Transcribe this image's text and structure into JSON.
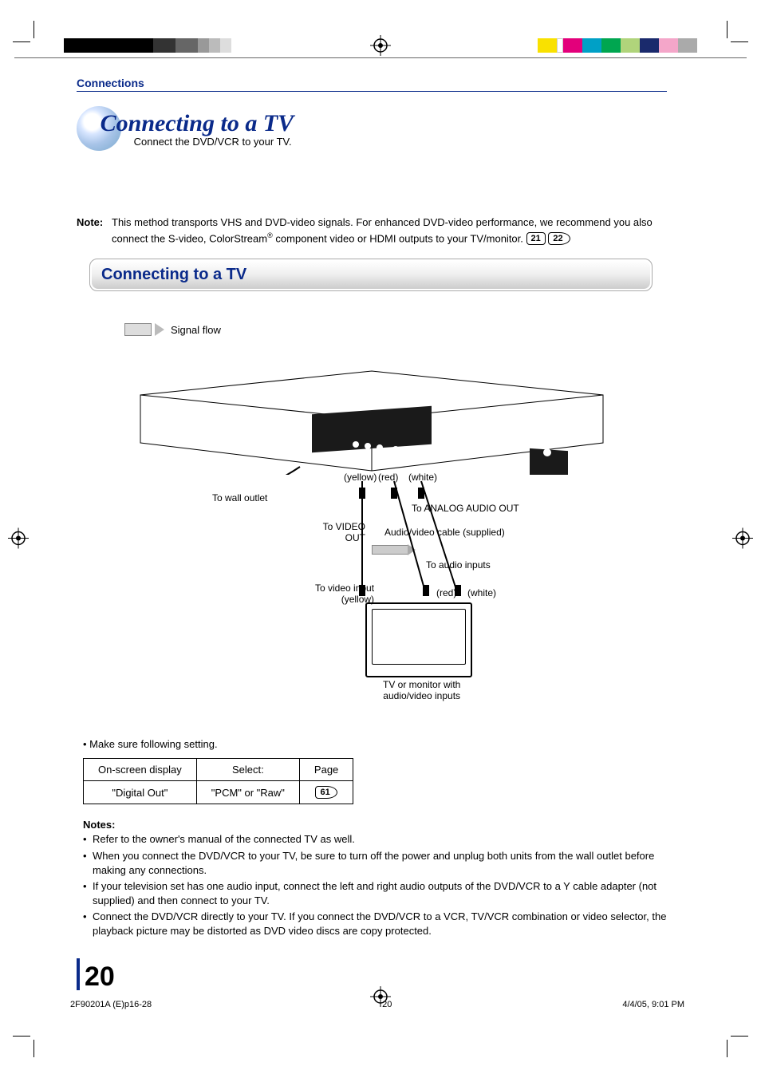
{
  "section_label": "Connections",
  "title": "Connecting to a TV",
  "subtitle": "Connect the DVD/VCR to your TV.",
  "note_label": "Note:",
  "note_text_pre": "This method transports VHS and DVD-video signals. For enhanced DVD-video performance, we recommend you also connect the S-video, ColorStream",
  "note_reg": "®",
  "note_text_post": " component video or HDMI outputs to your TV/monitor. ",
  "note_ref1": "21",
  "note_ref2": "22",
  "proc_heading": "Connecting to a TV",
  "diagram": {
    "signal_flow": "Signal flow",
    "to_wall": "To wall outlet",
    "yellow": "(yellow)",
    "red": "(red)",
    "white": "(white)",
    "to_analog_audio": "To ANALOG AUDIO OUT",
    "to_video_out_1": "To VIDEO",
    "to_video_out_2": "OUT",
    "av_cable": "Audio/video cable (supplied)",
    "to_audio_inputs": "To audio inputs",
    "to_video_input": "To video input",
    "yellow2": "(yellow)",
    "red2": "(red)",
    "white2": "(white)",
    "tv_caption_1": "TV or monitor with",
    "tv_caption_2": "audio/video inputs"
  },
  "setting_intro": "• Make sure following setting.",
  "table": {
    "h1": "On-screen display",
    "h2": "Select:",
    "h3": "Page",
    "r1c1": "\"Digital Out\"",
    "r1c2": "\"PCM\" or \"Raw\"",
    "r1c3": "61"
  },
  "notes_head": "Notes:",
  "notes": [
    "Refer to the owner's manual of the connected TV as well.",
    "When you connect the DVD/VCR to your TV, be sure to turn off the power and unplug both units from the wall outlet before making any connections.",
    "If your television set has one audio input, connect the left and right audio outputs of the DVD/VCR to a Y cable adapter (not supplied) and then connect to your TV.",
    "Connect the DVD/VCR directly to your TV. If you connect the DVD/VCR to a VCR, TV/VCR combination or video selector, the playback picture may be distorted as DVD video discs are copy protected."
  ],
  "page_number": "20",
  "footer": {
    "file": "2F90201A (E)p16-28",
    "pg": "20",
    "date": "4/4/05, 9:01 PM"
  },
  "colors": {
    "y": "#f9e100",
    "m": "#e3007b",
    "c": "#00a0c6",
    "g": "#00a650",
    "lg": "#b0d47b",
    "navy": "#1a2a6c",
    "pk": "#f4a6c9",
    "gr": "#aaa"
  }
}
